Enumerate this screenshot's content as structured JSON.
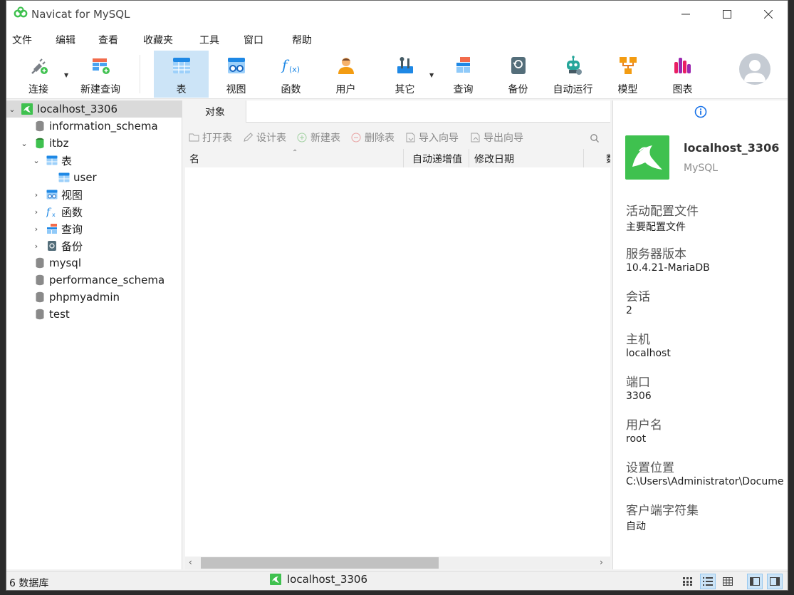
{
  "window": {
    "title": "Navicat for MySQL"
  },
  "menu": [
    "文件",
    "编辑",
    "查看",
    "收藏夹",
    "工具",
    "窗口",
    "帮助"
  ],
  "toolbar": {
    "connect": "连接",
    "new_query": "新建查询",
    "table": "表",
    "view": "视图",
    "function": "函数",
    "user": "用户",
    "other": "其它",
    "query": "查询",
    "backup": "备份",
    "automation": "自动运行",
    "model": "模型",
    "chart": "图表"
  },
  "tree": {
    "connection": "localhost_3306",
    "databases": [
      "information_schema",
      "itbz",
      "mysql",
      "performance_schema",
      "phpmyadmin",
      "test"
    ],
    "itbz_children": {
      "tables": "表",
      "table_user": "user",
      "views": "视图",
      "functions": "函数",
      "queries": "查询",
      "backups": "备份"
    }
  },
  "center": {
    "tab": "对象",
    "actions": [
      "打开表",
      "设计表",
      "新建表",
      "删除表",
      "导入向导",
      "导出向导"
    ],
    "columns": [
      "名",
      "自动递增值",
      "修改日期",
      "数"
    ]
  },
  "info": {
    "name": "localhost_3306",
    "type": "MySQL",
    "props": [
      {
        "key": "活动配置文件",
        "value": "主要配置文件"
      },
      {
        "key": "服务器版本",
        "value": "10.4.21-MariaDB"
      },
      {
        "key": "会话",
        "value": "2"
      },
      {
        "key": "主机",
        "value": "localhost"
      },
      {
        "key": "端口",
        "value": "3306"
      },
      {
        "key": "用户名",
        "value": "root"
      },
      {
        "key": "设置位置",
        "value": "C:\\Users\\Administrator\\Documents"
      },
      {
        "key": "客户端字符集",
        "value": "自动"
      }
    ]
  },
  "status": {
    "db_count": "6 数据库",
    "connection": "localhost_3306"
  },
  "colors": {
    "accent_selected": "#cce4f7",
    "navicat_green": "#3fc14f",
    "info_blue": "#1a73e8"
  }
}
